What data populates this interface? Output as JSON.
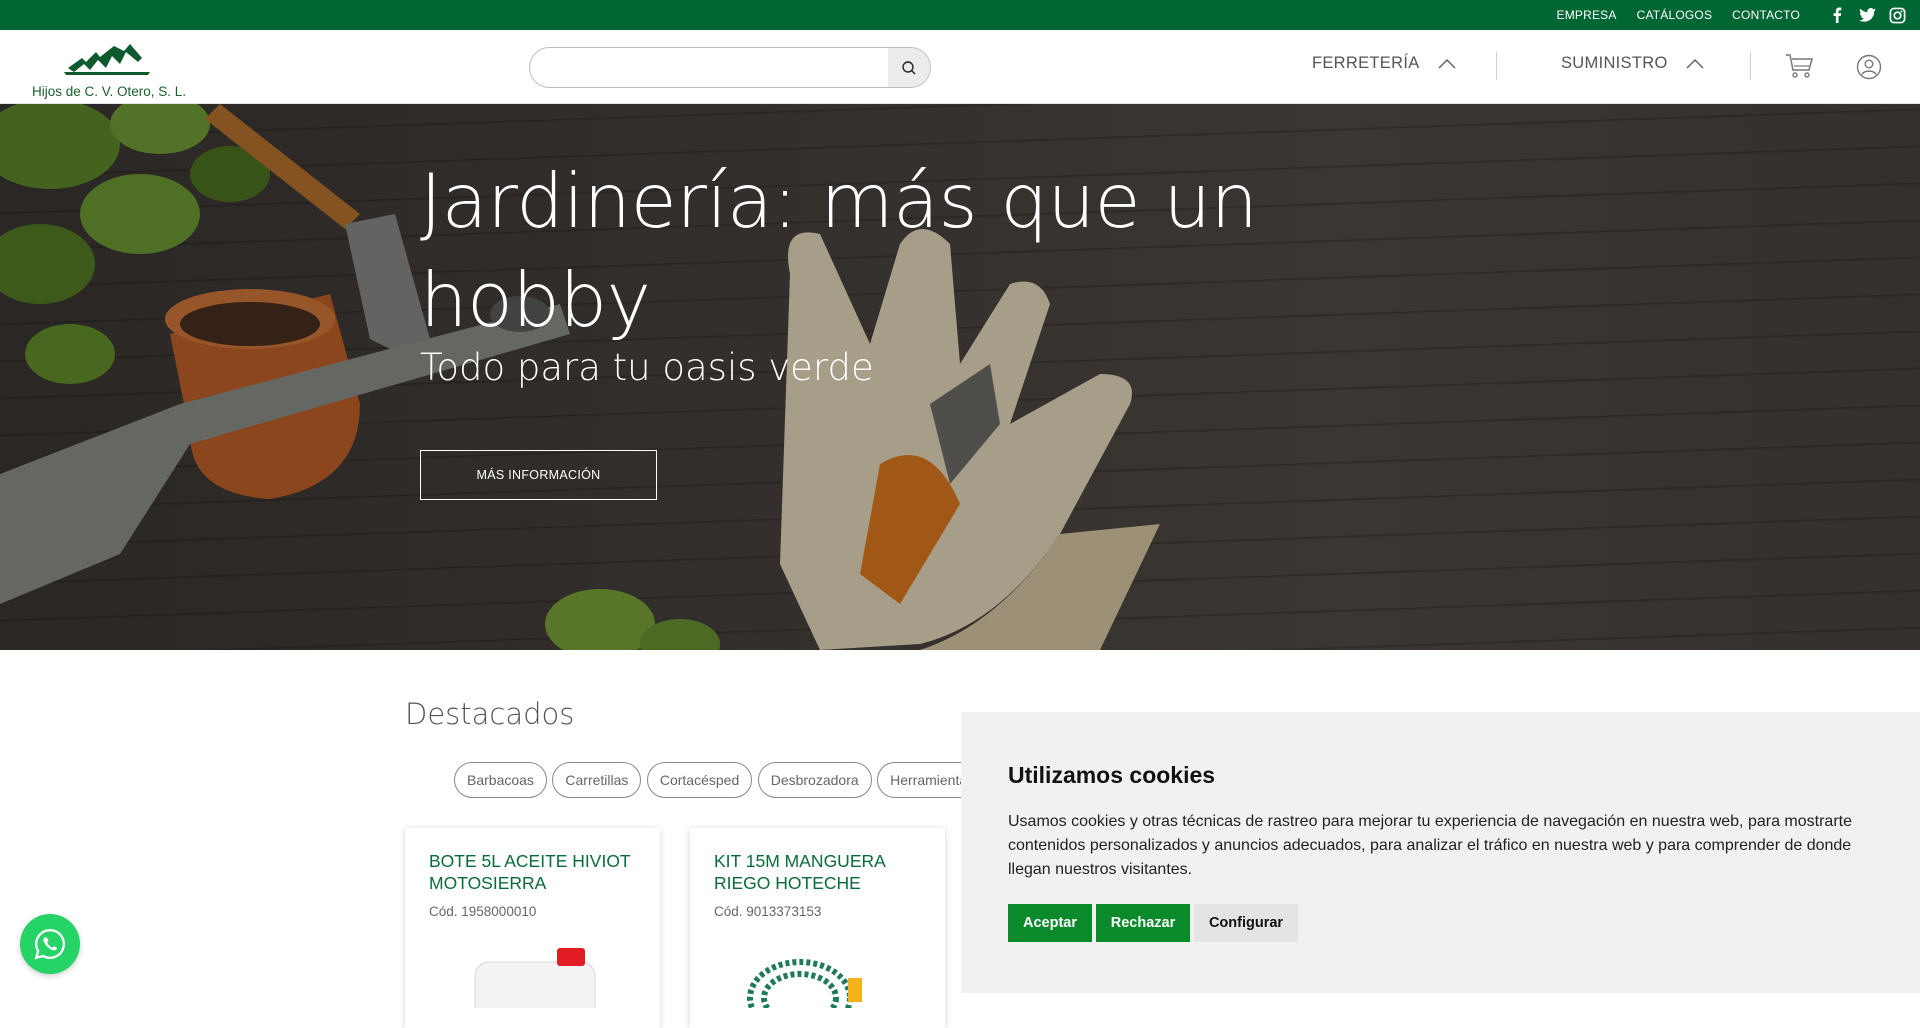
{
  "topbar": {
    "links": [
      "EMPRESA",
      "CATÁLOGOS",
      "CONTACTO"
    ],
    "social": [
      "facebook-icon",
      "twitter-icon",
      "instagram-icon"
    ]
  },
  "header": {
    "logo_text": "Hijos de C. V. Otero, S. L.",
    "search_placeholder": "",
    "nav": [
      {
        "label": "FERRETERÍA",
        "icon": "chevron-up-icon"
      },
      {
        "label": "SUMINISTRO",
        "icon": "chevron-up-icon"
      }
    ],
    "icons": [
      "cart-icon",
      "user-icon",
      "search-icon"
    ]
  },
  "hero": {
    "title": "Jardinería: más que un hobby",
    "subtitle": "Todo para tu oasis verde",
    "button_label": "MÁS INFORMACIÓN"
  },
  "featured": {
    "title": "Destacados",
    "chips": [
      "Barbacoas",
      "Carretillas",
      "Cortacésped",
      "Desbrozadora",
      "Herramientas"
    ],
    "products": [
      {
        "name": "BOTE 5L ACEITE HIVIOT MOTOSIERRA",
        "code": "Cód. 1958000010"
      },
      {
        "name": "KIT 15M MANGUERA RIEGO HOTECHE",
        "code": "Cód. 9013373153"
      }
    ]
  },
  "cookies": {
    "title": "Utilizamos cookies",
    "text": "Usamos cookies y otras técnicas de rastreo para mejorar tu experiencia de navegación en nuestra web, para mostrarte contenidos personalizados y anuncios adecuados, para analizar el tráfico en nuestra web y para comprender de donde llegan nuestros visitantes.",
    "accept_label": "Aceptar",
    "reject_label": "Rechazar",
    "config_label": "Configurar"
  },
  "colors": {
    "brand_green": "#006633",
    "accent_green": "#0a8a2a",
    "whatsapp": "#25d366"
  }
}
